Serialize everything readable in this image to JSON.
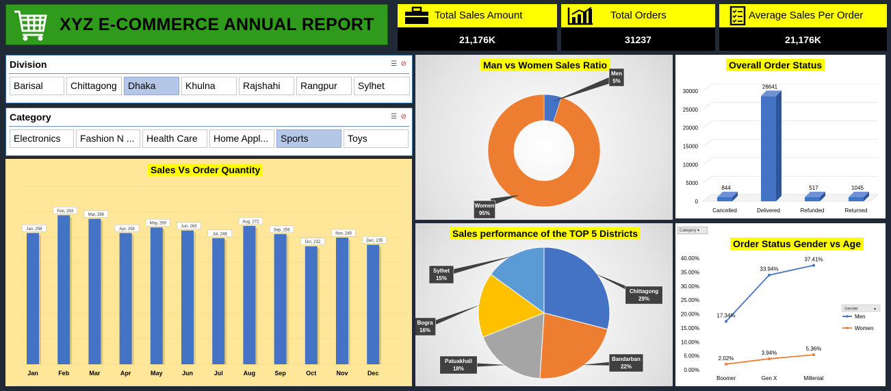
{
  "header": {
    "title": "XYZ E-COMMERCE ANNUAL REPORT"
  },
  "kpis": [
    {
      "label": "Total Sales Amount",
      "value": "21,176K",
      "icon": "briefcase-icon"
    },
    {
      "label": "Total Orders",
      "value": "31237",
      "icon": "bar-chart-icon"
    },
    {
      "label": "Average Sales Per Order",
      "value": "21,176K",
      "icon": "checklist-icon"
    }
  ],
  "division_slicer": {
    "title": "Division",
    "items": [
      "Barisal",
      "Chittagong",
      "Dhaka",
      "Khulna",
      "Rajshahi",
      "Rangpur",
      "Sylhet"
    ],
    "selected": "Dhaka"
  },
  "category_slicer": {
    "title": "Category",
    "items": [
      "Electronics",
      "Fashion N ...",
      "Health Care",
      "Home Appl...",
      "Sports",
      "Toys"
    ],
    "selected": "Sports"
  },
  "colors": {
    "accent_yellow": "#ffff00",
    "bar_blue": "#4472c4",
    "orange": "#ed7d31",
    "gray": "#a5a5a5",
    "gold": "#ffc000",
    "light_blue": "#5b9bd5",
    "title_green": "#2f9a1c"
  },
  "chart_data": [
    {
      "id": "sales-vs-qty",
      "type": "bar",
      "title": "Sales Vs Order Quantity",
      "categories": [
        "Jan",
        "Feb",
        "Mar",
        "Apr",
        "May",
        "Jun",
        "Jul",
        "Aug",
        "Sep",
        "Oct",
        "Nov",
        "Dec"
      ],
      "values": [
        258,
        293,
        286,
        258,
        269,
        263,
        248,
        272,
        256,
        232,
        249,
        235
      ],
      "data_labels": [
        "Jan, 258",
        "Feb, 293",
        "Mar, 286",
        "Apr, 258",
        "May, 269",
        "Jun, 263",
        "Jul, 248",
        "Aug, 272",
        "Sep, 256",
        "Oct, 232",
        "Nov, 249",
        "Dec, 235"
      ]
    },
    {
      "id": "gender-ratio",
      "type": "pie",
      "title": "Man vs Women Sales Ratio",
      "labels": [
        "Men",
        "Women"
      ],
      "values": [
        5,
        95
      ],
      "value_labels": [
        "5%",
        "95%"
      ]
    },
    {
      "id": "order-status",
      "type": "bar",
      "title": "Overall Order Status",
      "categories": [
        "Cancelled",
        "Delivered",
        "Refunded",
        "Returned"
      ],
      "values": [
        844,
        28641,
        517,
        1045
      ],
      "yticks": [
        "30000",
        "25000",
        "20000",
        "15000",
        "10000",
        "5000",
        "0"
      ],
      "ylim": [
        0,
        30000
      ]
    },
    {
      "id": "top-districts",
      "type": "pie",
      "title": "Sales performance of the TOP 5 Districts",
      "labels": [
        "Chittagong",
        "Bandarban",
        "Patuakhali",
        "Bogra",
        "Sylhet"
      ],
      "values": [
        29,
        22,
        18,
        16,
        15
      ],
      "value_labels": [
        "29%",
        "22%",
        "18%",
        "16%",
        "15%"
      ]
    },
    {
      "id": "gender-age",
      "type": "line",
      "title": "Order Status Gender vs Age",
      "filter_label": "Category",
      "legend_title": "Gender",
      "categories": [
        "Boomer",
        "Gen X",
        "Millenial"
      ],
      "series": [
        {
          "name": "Men",
          "values": [
            17.34,
            33.94,
            37.41
          ],
          "labels": [
            "17.34%",
            "33.94%",
            "37.41%"
          ]
        },
        {
          "name": "Women",
          "values": [
            2.02,
            3.94,
            5.36
          ],
          "labels": [
            "2.02%",
            "3.94%",
            "5.36%"
          ]
        }
      ],
      "yticks": [
        "40.00%",
        "35.00%",
        "30.00%",
        "25.00%",
        "20.00%",
        "15.00%",
        "10.00%",
        "5.00%",
        "0.00%"
      ],
      "ylim": [
        0,
        40
      ]
    }
  ]
}
